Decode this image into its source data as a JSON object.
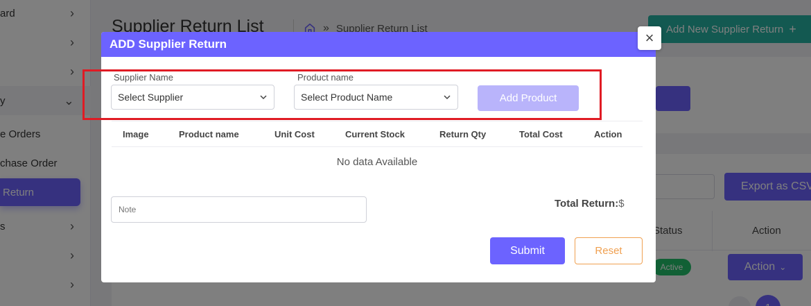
{
  "sidebar": {
    "items": [
      {
        "label": "ard",
        "chevron": "chevron-right-icon"
      },
      {
        "label": "",
        "chevron": "chevron-right-icon"
      },
      {
        "label": "",
        "chevron": "chevron-right-icon"
      },
      {
        "label": "y",
        "chevron": "chevron-down-icon"
      },
      {
        "label": "e Orders"
      },
      {
        "label": "chase Order"
      },
      {
        "label": "Return"
      },
      {
        "label": "s",
        "chevron": "chevron-right-icon"
      },
      {
        "label": "",
        "chevron": "chevron-right-icon"
      },
      {
        "label": "",
        "chevron": "chevron-right-icon"
      }
    ]
  },
  "page": {
    "title": "Supplier Return List",
    "breadcrumb_sep": "»",
    "breadcrumb_current": "Supplier Return List",
    "add_new_label": "Add New Supplier Return",
    "add_new_icon": "+"
  },
  "list": {
    "export_label": "Export as CSV",
    "col_status": "Status",
    "col_action": "Action",
    "row_status": "Active",
    "row_action": "Action",
    "page_number": "1"
  },
  "modal": {
    "title": "ADD Supplier Return",
    "close_icon": "×",
    "supplier_label": "Supplier Name",
    "supplier_value": "Select Supplier",
    "product_label": "Product name",
    "product_value": "Select Product Name",
    "add_product_label": "Add Product",
    "columns": [
      "Image",
      "Product name",
      "Unit Cost",
      "Current Stock",
      "Return Qty",
      "Total Cost",
      "Action"
    ],
    "empty_text": "No data Available",
    "note_placeholder": "Note",
    "total_label": "Total Return:",
    "total_currency": "$",
    "submit_label": "Submit",
    "reset_label": "Reset"
  },
  "colors": {
    "primary": "#6c63ff",
    "teal": "#26b3a3",
    "highlight": "#e01b24",
    "reset": "#f0a050",
    "success": "#22c06a"
  }
}
